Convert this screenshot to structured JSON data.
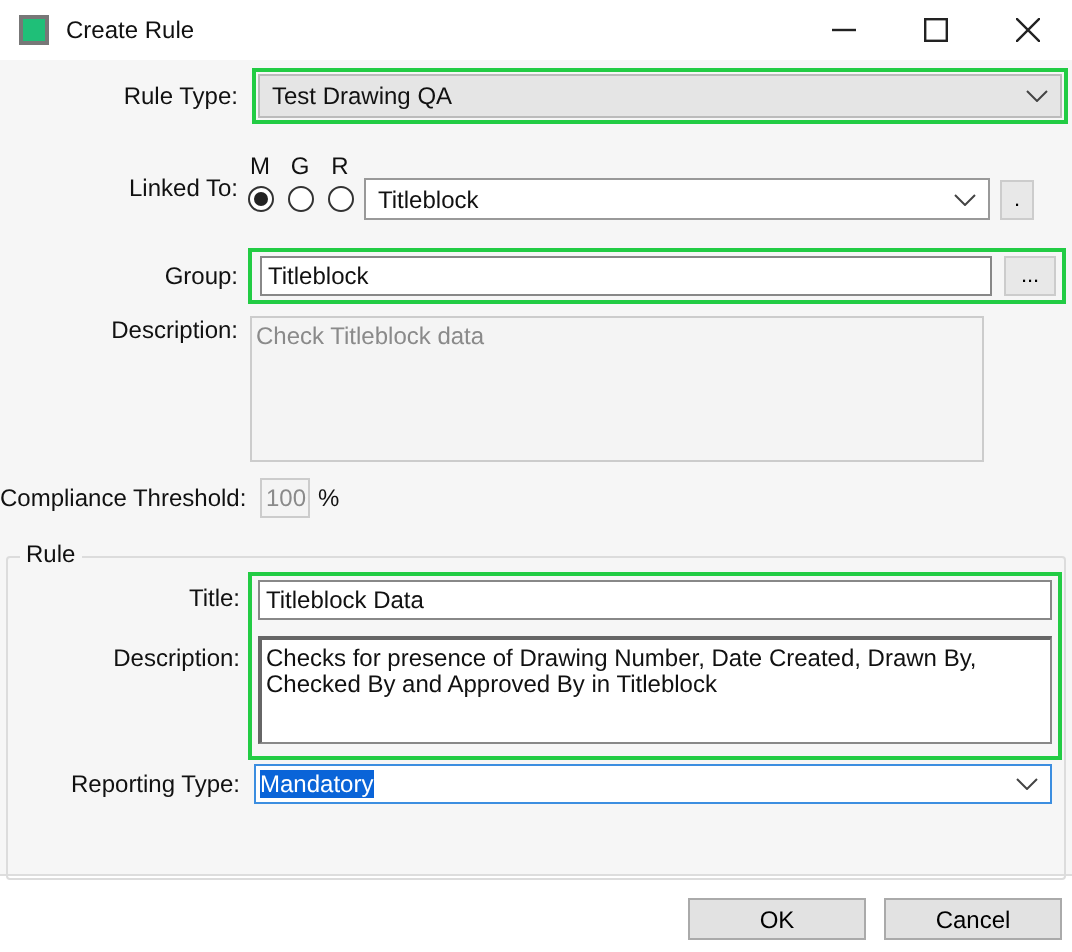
{
  "window": {
    "title": "Create Rule"
  },
  "rule_type": {
    "label": "Rule Type:",
    "value": "Test Drawing QA",
    "highlighted": true
  },
  "linked_to": {
    "label": "Linked To:",
    "options": [
      {
        "label": "M",
        "selected": true
      },
      {
        "label": "G",
        "selected": false
      },
      {
        "label": "R",
        "selected": false
      }
    ],
    "value": "Titleblock",
    "button": "."
  },
  "group": {
    "label": "Group:",
    "value": "Titleblock",
    "button": "...",
    "highlighted": true
  },
  "description": {
    "label": "Description:",
    "value": "Check Titleblock data",
    "disabled": true
  },
  "compliance_threshold": {
    "label": "Compliance Threshold:",
    "value": "100",
    "unit": "%",
    "disabled": true
  },
  "rule": {
    "heading": "Rule",
    "highlighted": true,
    "title": {
      "label": "Title:",
      "value": "Titleblock Data"
    },
    "description": {
      "label": "Description:",
      "value": "Checks for presence of Drawing Number, Date Created, Drawn By, Checked By and Approved By in Titleblock"
    },
    "reporting_type": {
      "label": "Reporting Type:",
      "value": "Mandatory",
      "text_selected": true
    }
  },
  "buttons": [
    "OK",
    "Cancel"
  ]
}
